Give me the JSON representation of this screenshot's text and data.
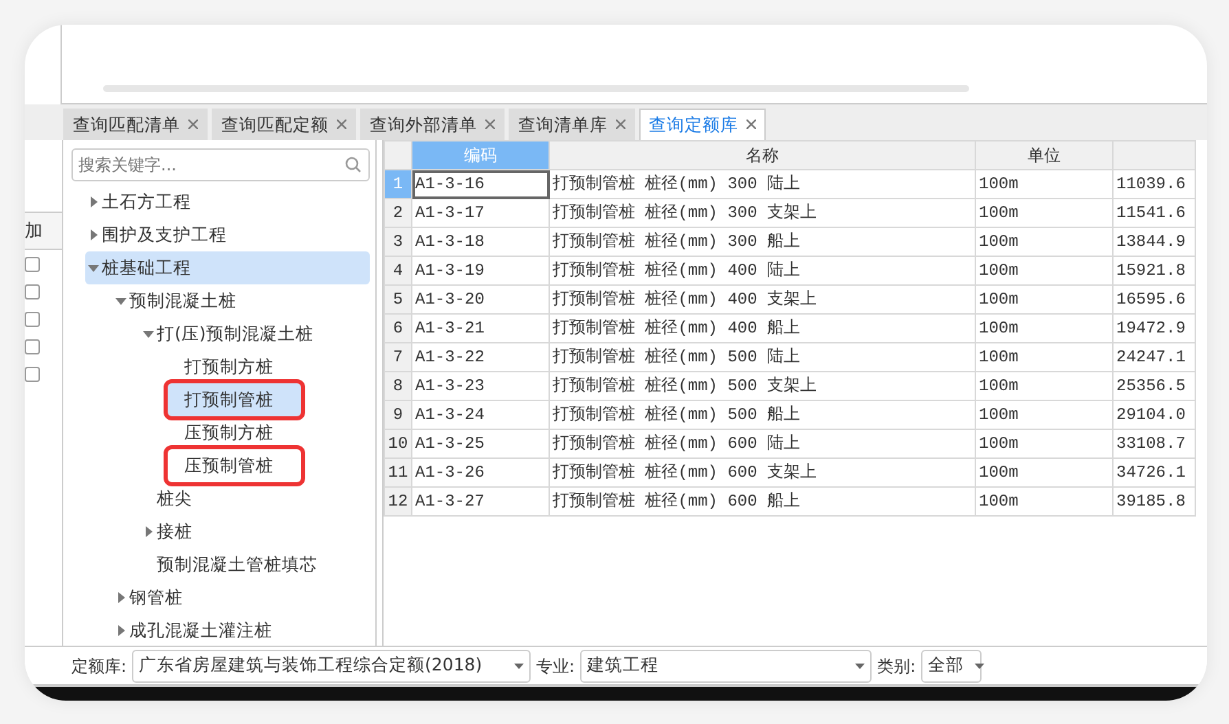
{
  "left_strip": {
    "header": "加",
    "checkboxes": [
      {
        "checked": false
      },
      {
        "checked": false
      },
      {
        "checked": false
      },
      {
        "checked": false
      },
      {
        "checked": false
      }
    ]
  },
  "tabs": [
    {
      "label": "查询匹配清单",
      "selected": false
    },
    {
      "label": "查询匹配定额",
      "selected": false
    },
    {
      "label": "查询外部清单",
      "selected": false
    },
    {
      "label": "查询清单库",
      "selected": false
    },
    {
      "label": "查询定额库",
      "selected": true
    }
  ],
  "search": {
    "placeholder": "搜索关键字..."
  },
  "tree": [
    {
      "label": "土石方工程",
      "expanded": false,
      "selected": false,
      "marked": false
    },
    {
      "label": "围护及支护工程",
      "expanded": false,
      "selected": false,
      "marked": false
    },
    {
      "label": "桩基础工程",
      "expanded": true,
      "selected": true,
      "marked": false,
      "children": [
        {
          "label": "预制混凝土桩",
          "expanded": true,
          "selected": false,
          "marked": false,
          "children": [
            {
              "label": "打(压)预制混凝土桩",
              "expanded": true,
              "selected": false,
              "marked": false,
              "children": [
                {
                  "label": "打预制方桩",
                  "selected": false,
                  "marked": false
                },
                {
                  "label": "打预制管桩",
                  "selected": true,
                  "marked": true
                },
                {
                  "label": "压预制方桩",
                  "selected": false,
                  "marked": false
                },
                {
                  "label": "压预制管桩",
                  "selected": false,
                  "marked": true
                }
              ]
            },
            {
              "label": "桩尖",
              "selected": false,
              "marked": false
            },
            {
              "label": "接桩",
              "expanded": false,
              "selected": false,
              "marked": false
            },
            {
              "label": "预制混凝土管桩填芯",
              "selected": false,
              "marked": false
            }
          ]
        },
        {
          "label": "钢管桩",
          "expanded": false,
          "selected": false,
          "marked": false
        },
        {
          "label": "成孔混凝土灌注桩",
          "expanded": false,
          "selected": false,
          "marked": false
        }
      ]
    }
  ],
  "table": {
    "columns": [
      "编码",
      "名称",
      "单位",
      ""
    ],
    "rows": [
      {
        "num": "1",
        "selected": true,
        "cells": [
          "A1-3-16",
          "打预制管桩 桩径(mm) 300 陆上",
          "100m",
          "11039.6"
        ]
      },
      {
        "num": "2",
        "selected": false,
        "cells": [
          "A1-3-17",
          "打预制管桩 桩径(mm) 300 支架上",
          "100m",
          "11541.6"
        ]
      },
      {
        "num": "3",
        "selected": false,
        "cells": [
          "A1-3-18",
          "打预制管桩 桩径(mm) 300 船上",
          "100m",
          "13844.9"
        ]
      },
      {
        "num": "4",
        "selected": false,
        "cells": [
          "A1-3-19",
          "打预制管桩 桩径(mm) 400 陆上",
          "100m",
          "15921.8"
        ]
      },
      {
        "num": "5",
        "selected": false,
        "cells": [
          "A1-3-20",
          "打预制管桩 桩径(mm) 400 支架上",
          "100m",
          "16595.6"
        ]
      },
      {
        "num": "6",
        "selected": false,
        "cells": [
          "A1-3-21",
          "打预制管桩 桩径(mm) 400 船上",
          "100m",
          "19472.9"
        ]
      },
      {
        "num": "7",
        "selected": false,
        "cells": [
          "A1-3-22",
          "打预制管桩 桩径(mm) 500 陆上",
          "100m",
          "24247.1"
        ]
      },
      {
        "num": "8",
        "selected": false,
        "cells": [
          "A1-3-23",
          "打预制管桩 桩径(mm) 500 支架上",
          "100m",
          "25356.5"
        ]
      },
      {
        "num": "9",
        "selected": false,
        "cells": [
          "A1-3-24",
          "打预制管桩 桩径(mm) 500 船上",
          "100m",
          "29104.0"
        ]
      },
      {
        "num": "10",
        "selected": false,
        "cells": [
          "A1-3-25",
          "打预制管桩 桩径(mm) 600 陆上",
          "100m",
          "33108.7"
        ]
      },
      {
        "num": "11",
        "selected": false,
        "cells": [
          "A1-3-26",
          "打预制管桩 桩径(mm) 600 支架上",
          "100m",
          "34726.1"
        ]
      },
      {
        "num": "12",
        "selected": false,
        "cells": [
          "A1-3-27",
          "打预制管桩 桩径(mm) 600 船上",
          "100m",
          "39185.8"
        ]
      }
    ]
  },
  "filters": [
    {
      "label": "定额库:",
      "value": "广东省房屋建筑与装饰工程综合定额(2018)"
    },
    {
      "label": "专业:",
      "value": "建筑工程"
    },
    {
      "label": "类别:",
      "value": "全部"
    }
  ]
}
